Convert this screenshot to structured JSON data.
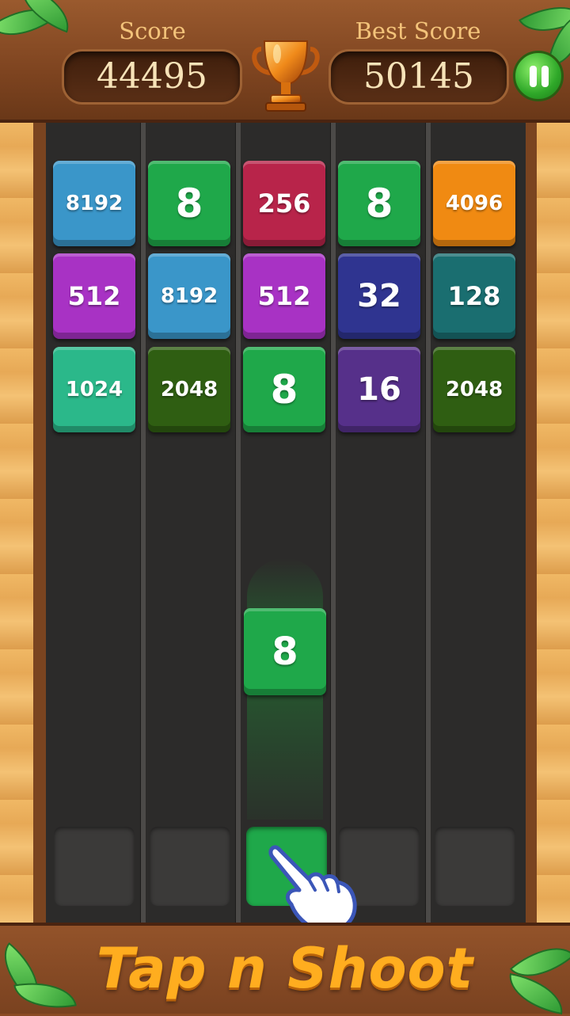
{
  "header": {
    "score_label": "Score",
    "score_value": "44495",
    "best_label": "Best Score",
    "best_value": "50145"
  },
  "colors": {
    "green_8": "#1fa84a",
    "blue_8192": "#3a96c9",
    "red_256": "#b8244a",
    "orange_4096": "#f08a12",
    "purple_512": "#a832c4",
    "navy_32": "#2f3490",
    "teal_128": "#1a6e70",
    "mint_1024": "#2bb88a",
    "olive_2048": "#2f5e12",
    "violet_16": "#56308a"
  },
  "columns": [
    {
      "tiles": [
        {
          "value": "8192",
          "color": "#3a96c9"
        },
        {
          "value": "512",
          "color": "#a832c4"
        },
        {
          "value": "1024",
          "color": "#2bb88a"
        }
      ]
    },
    {
      "tiles": [
        {
          "value": "8",
          "color": "#1fa84a"
        },
        {
          "value": "8192",
          "color": "#3a96c9"
        },
        {
          "value": "2048",
          "color": "#2f5e12"
        }
      ]
    },
    {
      "tiles": [
        {
          "value": "256",
          "color": "#b8244a"
        },
        {
          "value": "512",
          "color": "#a832c4"
        },
        {
          "value": "8",
          "color": "#1fa84a"
        }
      ]
    },
    {
      "tiles": [
        {
          "value": "8",
          "color": "#1fa84a"
        },
        {
          "value": "32",
          "color": "#2f3490"
        },
        {
          "value": "16",
          "color": "#56308a"
        }
      ]
    },
    {
      "tiles": [
        {
          "value": "4096",
          "color": "#f08a12"
        },
        {
          "value": "128",
          "color": "#1a6e70"
        },
        {
          "value": "2048",
          "color": "#2f5e12"
        }
      ]
    }
  ],
  "flying_tile": {
    "value": "8",
    "color": "#1fa84a"
  },
  "next_tile": {
    "color": "#1fa84a",
    "column": 3
  },
  "footer": {
    "cta": "Tap n Shoot"
  },
  "icons": [
    "trophy-icon",
    "pause-icon",
    "pointing-hand-icon",
    "leaf-icon"
  ]
}
